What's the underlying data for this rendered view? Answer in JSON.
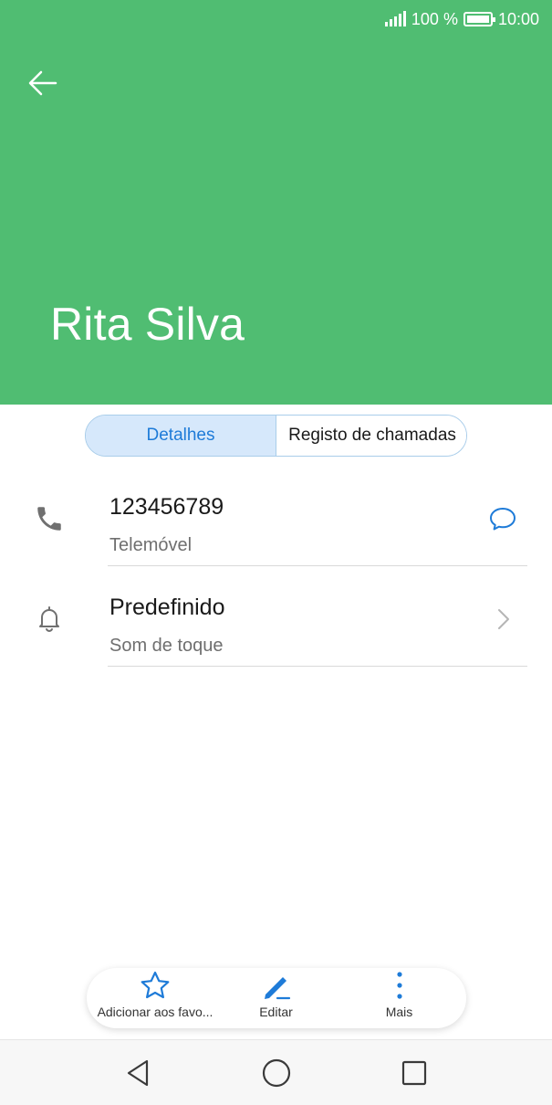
{
  "status_bar": {
    "battery_text": "100 %",
    "time": "10:00"
  },
  "header": {
    "contact_name": "Rita Silva",
    "background_color": "#50bd72"
  },
  "tabs": [
    {
      "label": "Detalhes",
      "active": true
    },
    {
      "label": "Registo de chamadas",
      "active": false
    }
  ],
  "details": {
    "phone": {
      "number": "123456789",
      "type": "Telemóvel",
      "icon": "phone-icon",
      "action_icon": "message-icon"
    },
    "ringtone": {
      "value": "Predefinido",
      "label": "Som de toque",
      "icon": "bell-icon",
      "action_icon": "chevron-right-icon"
    }
  },
  "actions": [
    {
      "label": "Adicionar aos favo...",
      "icon": "star-icon"
    },
    {
      "label": "Editar",
      "icon": "edit-icon"
    },
    {
      "label": "Mais",
      "icon": "more-icon"
    }
  ],
  "accent_color": "#1e7bd8"
}
